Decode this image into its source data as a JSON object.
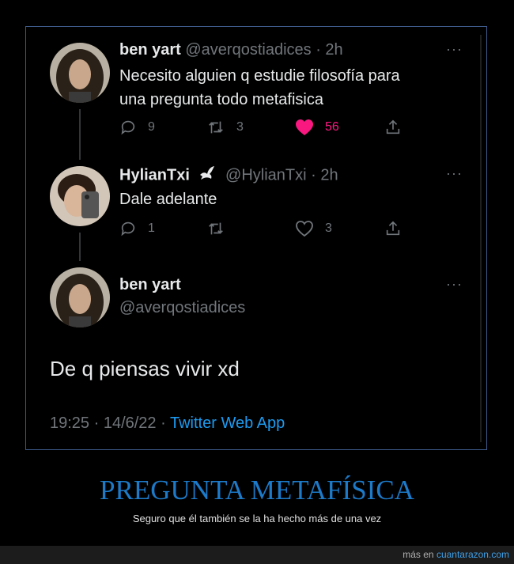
{
  "tweets": [
    {
      "name": "ben yart",
      "handle": "@averqostiadices",
      "time": "· 2h",
      "text_lines": [
        "Necesito alguien q estudie filosofía para",
        "una pregunta todo metafisica"
      ],
      "replies": "9",
      "retweets": "3",
      "likes": "56"
    },
    {
      "name": "HylianTxi",
      "badge_icon": "dove-icon",
      "handle": "@HylianTxi",
      "time": "· 2h",
      "text": "Dale adelante",
      "replies": "1",
      "retweets": "",
      "likes": "3"
    }
  ],
  "main_tweet": {
    "name": "ben yart",
    "handle": "@averqostiadices",
    "text": "De q piensas vivir xd",
    "timestamp": "19:25 · 14/6/22 ·",
    "app": "Twitter Web App"
  },
  "menu_dots": "···",
  "caption": {
    "title": "PREGUNTA METAFÍSICA",
    "subtitle": "Seguro que él también se la ha hecho más de una vez"
  },
  "footer": {
    "prefix": "más en",
    "site": "cuantarazon.com"
  },
  "colors": {
    "like": "#f91880",
    "link": "#1d9bf0",
    "caption": "#1d7ac9"
  }
}
